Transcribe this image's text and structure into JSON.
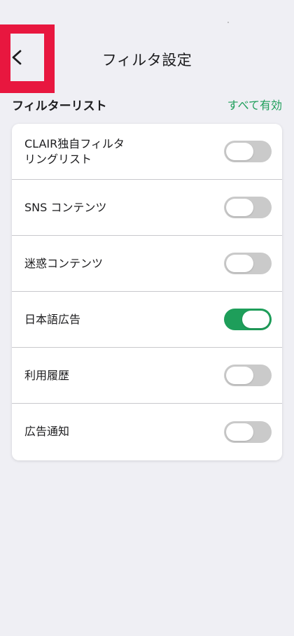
{
  "header": {
    "title": "フィルタ設定",
    "back_icon": "chevron-left-icon"
  },
  "section": {
    "title": "フィルターリスト",
    "enable_all_label": "すべて有効"
  },
  "filters": [
    {
      "label": "CLAIR独自フィルタ\nリングリスト",
      "enabled": false
    },
    {
      "label": "SNS コンテンツ",
      "enabled": false
    },
    {
      "label": "迷惑コンテンツ",
      "enabled": false
    },
    {
      "label": "日本語広告",
      "enabled": true
    },
    {
      "label": "利用履歴",
      "enabled": false
    },
    {
      "label": "広告通知",
      "enabled": false
    }
  ],
  "colors": {
    "accent": "#1e9e5a",
    "highlight": "#e8173f",
    "toggle_off": "#cacaca",
    "background": "#efeff4"
  }
}
